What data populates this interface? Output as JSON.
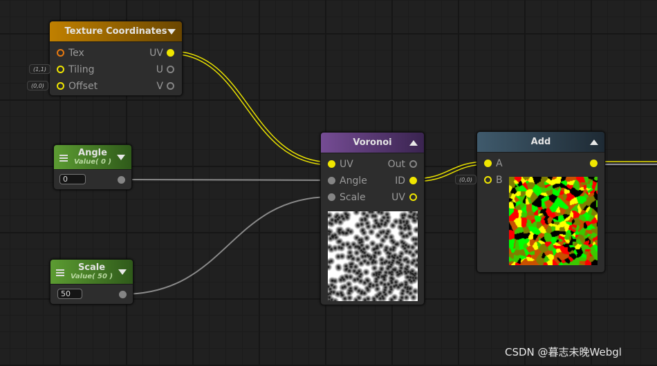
{
  "nodes": {
    "texcoord": {
      "title": "Texture Coordinates",
      "inputs": [
        "Tex",
        "Tiling",
        "Offset"
      ],
      "outputs": [
        "UV",
        "U",
        "V"
      ],
      "tiling_default": "(1,1)",
      "offset_default": "(0,0)",
      "header_color": "#b87a00"
    },
    "angle": {
      "title": "Angle",
      "subtitle": "Value( 0 )",
      "value": "0",
      "header_color": "#4f8a2a"
    },
    "scale": {
      "title": "Scale",
      "subtitle": "Value( 50 )",
      "value": "50",
      "header_color": "#4f8a2a"
    },
    "voronoi": {
      "title": "Voronoi",
      "inputs": [
        "UV",
        "Angle",
        "Scale"
      ],
      "outputs": [
        "Out",
        "ID",
        "UV"
      ],
      "header_color": "#6a4488"
    },
    "add": {
      "title": "Add",
      "inputs": [
        "A",
        "B"
      ],
      "b_default": "(0,0)",
      "header_color": "#3a5060"
    }
  },
  "watermark": "CSDN @暮志未晚Webgl"
}
